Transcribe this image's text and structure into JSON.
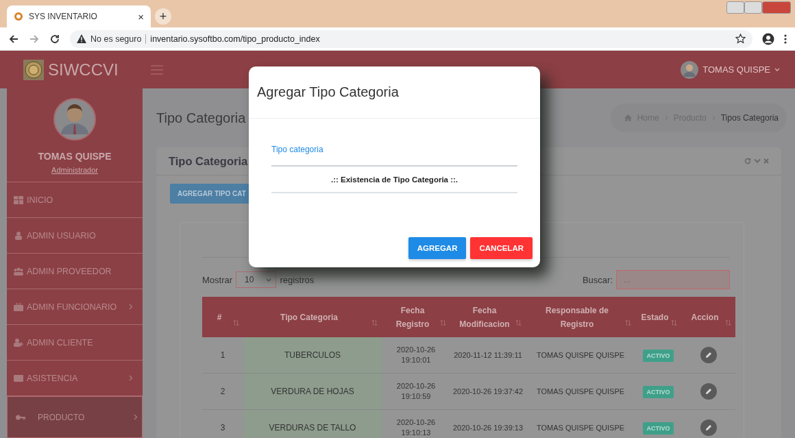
{
  "browser": {
    "tab_title": "SYS INVENTARIO",
    "tab_close": "×",
    "new_tab": "+",
    "security": "No es seguro",
    "url": "inventario.sysoftbo.com/tipo_producto_index"
  },
  "header": {
    "brand": "SIWCCVI",
    "user": "TOMAS QUISPE"
  },
  "sidebar": {
    "user_name": "TOMAS QUISPE",
    "role": "Administrador",
    "items": [
      {
        "label": "INICIO",
        "has_submenu": false,
        "selected": false
      },
      {
        "label": "ADMIN USUARIO",
        "has_submenu": false,
        "selected": false
      },
      {
        "label": "ADMIN PROVEEDOR",
        "has_submenu": false,
        "selected": false
      },
      {
        "label": "ADMIN FUNCIONARIO",
        "has_submenu": true,
        "selected": false
      },
      {
        "label": "ADMIN CLIENTE",
        "has_submenu": false,
        "selected": false
      },
      {
        "label": "ASISTENCIA",
        "has_submenu": true,
        "selected": false
      },
      {
        "label": "PRODUCTO",
        "has_submenu": true,
        "selected": true
      }
    ]
  },
  "page": {
    "title": "Tipo Categoria",
    "breadcrumb": [
      {
        "label": "Home",
        "current": false
      },
      {
        "label": "Producto",
        "current": false
      },
      {
        "label": "Tipos Categoria",
        "current": true
      }
    ]
  },
  "card": {
    "title": "Tipo Categoria",
    "add_button": "AGREGAR TIPO CAT",
    "length_label": "Mostrar",
    "length_value": "10",
    "length_suffix": "registros",
    "search_label": "Buscar:",
    "search_placeholder": "..."
  },
  "table": {
    "columns": [
      "#",
      "Tipo Categoria",
      "Fecha Registro",
      "Fecha Modificacion",
      "Responsable de Registro",
      "Estado",
      "Accion"
    ],
    "rows": [
      {
        "num": "1",
        "tipo": "TUBERCULOS",
        "registro": "2020-10-26 19:10:01",
        "modificacion": "2020-11-12 11:39:11",
        "responsable": "TOMAS QUISPE QUISPE",
        "estado": "ACTIVO"
      },
      {
        "num": "2",
        "tipo": "VERDURA DE HOJAS",
        "registro": "2020-10-26 19:10:59",
        "modificacion": "2020-10-26 19:37:42",
        "responsable": "TOMAS QUISPE QUISPE",
        "estado": "ACTIVO"
      },
      {
        "num": "3",
        "tipo": "VERDURAS DE TALLO",
        "registro": "2020-10-26 19:10:13",
        "modificacion": "2020-10-26 19:39:13",
        "responsable": "TOMAS QUISPE QUISPE",
        "estado": "ACTIVO"
      }
    ]
  },
  "modal": {
    "title": "Agregar Tipo Categoria",
    "field_label": "Tipo categoria",
    "notice": ".:: Existencia de Tipo Categoria ::.",
    "confirm": "AGREGAR",
    "cancel": "CANCELAR"
  }
}
